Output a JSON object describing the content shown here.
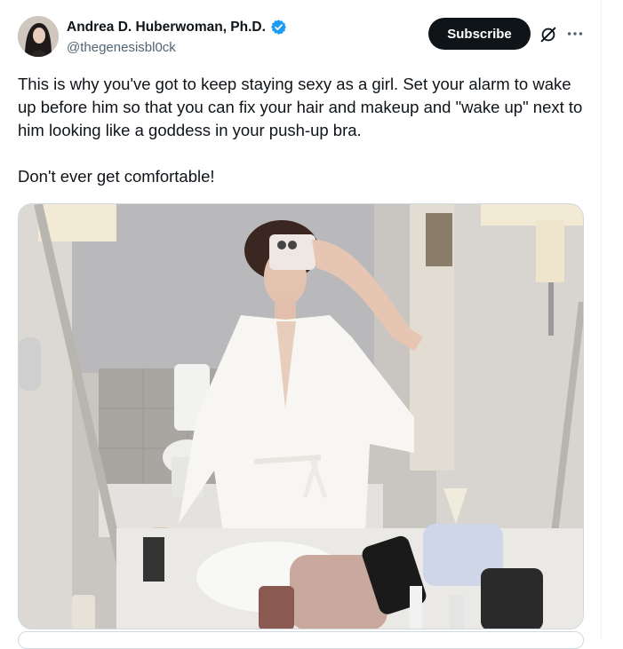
{
  "author": {
    "display_name": "Andrea D. Huberwoman, Ph.D.",
    "handle": "@thegenesisbl0ck",
    "verified_icon": "verified-badge-icon"
  },
  "actions": {
    "subscribe_label": "Subscribe",
    "grok_icon": "grok-icon",
    "more_icon": "more-options-icon"
  },
  "tweet": {
    "paragraph_1": "This is why you've got to keep staying sexy as a girl. Set your alarm to wake up before him so that you can fix your hair and makeup and \"wake up\" next to him looking like a goddess in your push-up bra.",
    "paragraph_2": "Don't ever get comfortable!"
  },
  "media": {
    "alt": "mirror selfie of a woman in a white robe in a bathroom"
  },
  "colors": {
    "accent": "#1d9bf0",
    "text": "#0f1419",
    "secondary": "#536471",
    "button": "#0f1419"
  }
}
